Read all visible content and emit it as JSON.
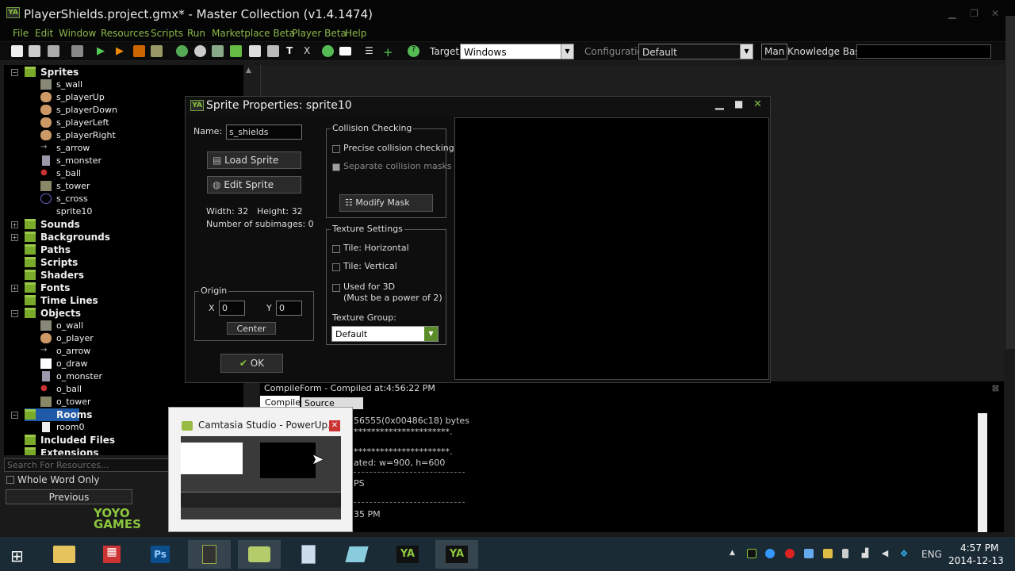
{
  "window": {
    "title": "PlayerShields.project.gmx*  -  Master Collection (v1.4.1474)"
  },
  "menu": [
    "File",
    "Edit",
    "Window",
    "Resources",
    "Scripts",
    "Run",
    "Marketplace Beta",
    "Player Beta",
    "Help"
  ],
  "toolbar": {
    "target_label": "Target:",
    "target_value": "Windows",
    "config_label": "Configuration:",
    "config_value": "Default",
    "man_label": "Man",
    "kb_label": "Knowledge Base:"
  },
  "tree": {
    "sprites": "Sprites",
    "sprite_items": [
      "s_wall",
      "s_playerUp",
      "s_playerDown",
      "s_playerLeft",
      "s_playerRight",
      "s_arrow",
      "s_monster",
      "s_ball",
      "s_tower",
      "s_cross",
      "sprite10"
    ],
    "folders": [
      "Sounds",
      "Backgrounds",
      "Paths",
      "Scripts",
      "Shaders",
      "Fonts",
      "Time Lines"
    ],
    "objects": "Objects",
    "object_items": [
      "o_wall",
      "o_player",
      "o_arrow",
      "o_draw",
      "o_monster",
      "o_ball",
      "o_tower"
    ],
    "rooms": "Rooms",
    "room_items": [
      "room0"
    ],
    "included": "Included Files",
    "extensions": "Extensions"
  },
  "search": {
    "placeholder": "Search For Resources...",
    "whole_word": "Whole Word Only",
    "previous": "Previous"
  },
  "dialog": {
    "title": "Sprite Properties: sprite10",
    "name_label": "Name:",
    "name_value": "s_shields",
    "load_sprite": "Load Sprite",
    "edit_sprite": "Edit Sprite",
    "width": "Width: 32",
    "height": "Height: 32",
    "subimages": "Number of subimages: 0",
    "origin_label": "Origin",
    "x_label": "X",
    "x_value": "0",
    "y_label": "Y",
    "y_value": "0",
    "center": "Center",
    "ok": "OK",
    "collision_label": "Collision Checking",
    "precise": "Precise collision checking",
    "separate": "Separate collision masks",
    "modify_mask": "Modify Mask",
    "texture_label": "Texture Settings",
    "tile_h": "Tile: Horizontal",
    "tile_v": "Tile: Vertical",
    "used_3d": "Used for 3D",
    "pow2": "(Must be a power of 2)",
    "texture_group_label": "Texture Group:",
    "texture_group_value": "Default"
  },
  "compile": {
    "status": "CompileForm - Compiled at:4:56:22 PM",
    "tab_compile": "Compile",
    "tab_source": "Source Control",
    "lines": [
      "56555(0x00486c18) bytes",
      "**********************.",
      "**********************.",
      "ated: w=900, h=600",
      "PS",
      "35 PM"
    ]
  },
  "thumbnail": {
    "title": "Camtasia Studio - PowerUp..."
  },
  "brand": {
    "logo_text": "YOYO GAMES"
  },
  "clock": {
    "time": "4:57 PM",
    "date": "2014-12-13",
    "lang": "ENG"
  }
}
